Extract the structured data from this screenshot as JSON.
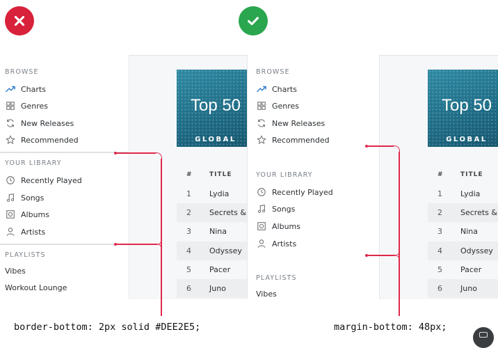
{
  "badges": {
    "bad": "x-icon",
    "good": "check-icon"
  },
  "colors": {
    "bad": "#d8213a",
    "good": "#2aa64f",
    "accent": "#e0284b",
    "divider": "#DEE2E5"
  },
  "sidebar": {
    "browse_title": "BROWSE",
    "browse_items": [
      {
        "label": "Charts",
        "icon": "chart-icon"
      },
      {
        "label": "Genres",
        "icon": "grid-icon"
      },
      {
        "label": "New Releases",
        "icon": "refresh-icon"
      },
      {
        "label": "Recommended",
        "icon": "star-icon"
      }
    ],
    "library_title": "YOUR LIBRARY",
    "library_items": [
      {
        "label": "Recently Played",
        "icon": "clock-icon"
      },
      {
        "label": "Songs",
        "icon": "music-note-icon"
      },
      {
        "label": "Albums",
        "icon": "album-icon"
      },
      {
        "label": "Artists",
        "icon": "user-icon"
      }
    ],
    "playlists_title": "PLAYLISTS",
    "playlists": [
      "Vibes",
      "Workout Lounge"
    ]
  },
  "cover": {
    "title": "Top 50",
    "subtitle": "GLOBAL"
  },
  "table": {
    "headers": {
      "num": "#",
      "title": "TITLE"
    },
    "rows": [
      {
        "n": "1",
        "title": "Lydia"
      },
      {
        "n": "2",
        "title": "Secrets & L"
      },
      {
        "n": "3",
        "title": "Nina"
      },
      {
        "n": "4",
        "title": "Odyssey"
      },
      {
        "n": "5",
        "title": "Pacer"
      },
      {
        "n": "6",
        "title": "Juno"
      }
    ],
    "right_row2_title": "Secrets & "
  },
  "captions": {
    "left": "border-bottom: 2px solid #DEE2E5;",
    "right": "margin-bottom: 48px;"
  }
}
